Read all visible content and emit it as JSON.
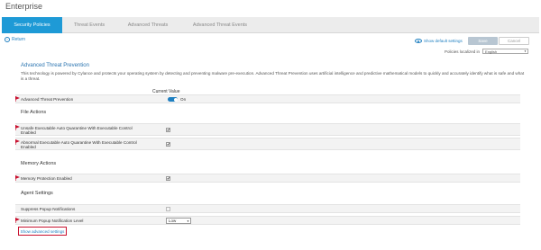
{
  "app": {
    "title": "Enterprise"
  },
  "tabs": [
    {
      "label": "Security Policies",
      "active": true
    },
    {
      "label": "Threat Events",
      "active": false
    },
    {
      "label": "Advanced Threats",
      "active": false
    },
    {
      "label": "Advanced Threat Events",
      "active": false
    }
  ],
  "toolbar": {
    "return_label": "Return",
    "show_default_label": "Show default settings",
    "save_label": "Save",
    "cancel_label": "Cancel",
    "localized_label": "Policies localized in",
    "language_value": "English"
  },
  "section": {
    "title": "Advanced Threat Prevention",
    "description": "This technology is powered by Cylance and protects your operating system by detecting and preventing malware pre-execution. Advanced Threat Prevention uses artificial intelligence and predictive mathematical models to quickly and accurately identify what is safe and what is a threat.",
    "current_value_label": "Current Value"
  },
  "settings": {
    "atp": {
      "label": "Advanced Threat Prevention",
      "value_label": "On",
      "enabled": true
    },
    "file_actions_heading": "File Actions",
    "unsafe_quarantine": {
      "label": "Unsafe Executable Auto Quarantine With Executable Control Enabled",
      "checked": true
    },
    "abnormal_quarantine": {
      "label": "Abnormal Executable Auto Quarantine With Executable Control Enabled",
      "checked": true
    },
    "memory_actions_heading": "Memory Actions",
    "memory_protection": {
      "label": "Memory Protection Enabled",
      "checked": true
    },
    "agent_settings_heading": "Agent Settings",
    "suppress_popup": {
      "label": "Suppress Popup Notifications",
      "checked": false
    },
    "min_popup_level": {
      "label": "Minimum Popup Notification Level",
      "value": "Low"
    }
  },
  "show_advanced_label": "Show advanced settings",
  "colors": {
    "accent": "#1e9ad6",
    "link": "#1e7fc0",
    "highlight_border": "#c8102e",
    "flag": "#c8102e"
  }
}
